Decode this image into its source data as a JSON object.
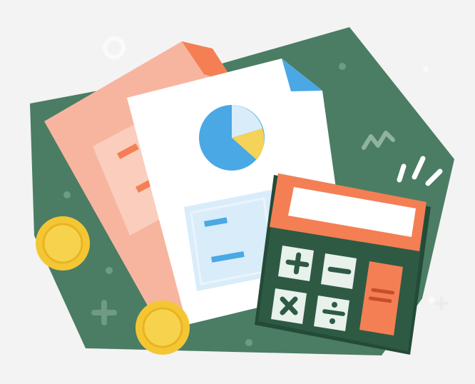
{
  "illustration": {
    "subject": "finance-documents-calculator",
    "palette": {
      "background": "#f3f3f3",
      "green_blob": "#4a7d64",
      "green_dark": "#244a38",
      "doc_back": "#f7b5a0",
      "doc_back_fold": "#f47f54",
      "doc_front": "#ffffff",
      "doc_front_fold": "#4aa8e4",
      "pie_blue": "#4aa8e4",
      "pie_light": "#d9ecfa",
      "pie_yellow": "#f5d258",
      "calculator_top": "#f47f54",
      "calculator_body": "#2e5a44",
      "screen": "#ffffff",
      "key_light": "#e8f1ec",
      "key_symbol": "#2e5a44",
      "equals_key": "#f47f54",
      "coin": "#f5c634",
      "coin_inner": "#f7d34d"
    },
    "icons": [
      "pie-chart-icon",
      "plus-key-icon",
      "minus-key-icon",
      "multiply-key-icon",
      "divide-key-icon",
      "equals-key-icon",
      "coin-icon",
      "sparkle-icon",
      "zigzag-icon"
    ]
  }
}
